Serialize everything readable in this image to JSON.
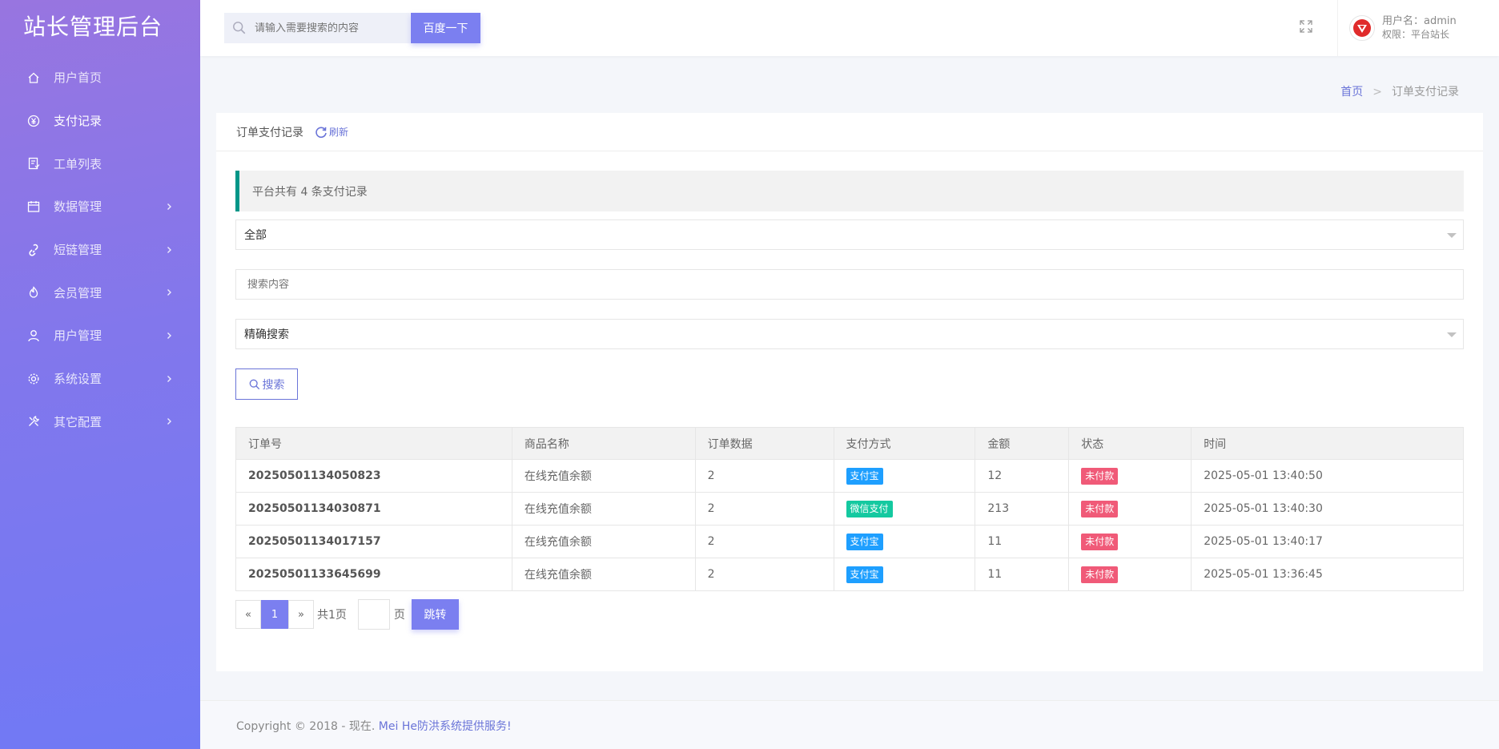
{
  "brand": "站长管理后台",
  "sidebar": {
    "items": [
      {
        "label": "用户首页",
        "icon": "home-icon",
        "has_arrow": false
      },
      {
        "label": "支付记录",
        "icon": "yen-icon",
        "has_arrow": false
      },
      {
        "label": "工单列表",
        "icon": "ticket-icon",
        "has_arrow": false
      },
      {
        "label": "数据管理",
        "icon": "calendar-icon",
        "has_arrow": true
      },
      {
        "label": "短链管理",
        "icon": "link-icon",
        "has_arrow": true
      },
      {
        "label": "会员管理",
        "icon": "fire-icon",
        "has_arrow": true
      },
      {
        "label": "用户管理",
        "icon": "user-icon",
        "has_arrow": true
      },
      {
        "label": "系统设置",
        "icon": "gear-icon",
        "has_arrow": true
      },
      {
        "label": "其它配置",
        "icon": "tools-icon",
        "has_arrow": true
      }
    ],
    "active_index": 1
  },
  "header": {
    "search_placeholder": "请输入需要搜索的内容",
    "search_button": "百度一下",
    "user_name": "用户名：admin",
    "user_role": "权限：平台站长"
  },
  "breadcrumb": {
    "home": "首页",
    "sep": ">",
    "current": "订单支付记录"
  },
  "card": {
    "title": "订单支付记录",
    "refresh_label": "刷新",
    "notice": "平台共有 4 条支付记录",
    "filter_select": "全部",
    "search_placeholder": "搜索内容",
    "mode_select": "精确搜索",
    "search_button": "搜索"
  },
  "table": {
    "headers": [
      "订单号",
      "商品名称",
      "订单数据",
      "支付方式",
      "金额",
      "状态",
      "时间"
    ],
    "rows": [
      {
        "order_no": "20250501134050823",
        "product": "在线充值余额",
        "data": "2",
        "pay": "支付宝",
        "amount": "12",
        "status": "未付款",
        "time": "2025-05-01 13:40:50"
      },
      {
        "order_no": "20250501134030871",
        "product": "在线充值余额",
        "data": "2",
        "pay": "微信支付",
        "amount": "213",
        "status": "未付款",
        "time": "2025-05-01 13:40:30"
      },
      {
        "order_no": "20250501134017157",
        "product": "在线充值余额",
        "data": "2",
        "pay": "支付宝",
        "amount": "11",
        "status": "未付款",
        "time": "2025-05-01 13:40:17"
      },
      {
        "order_no": "20250501133645699",
        "product": "在线充值余额",
        "data": "2",
        "pay": "支付宝",
        "amount": "11",
        "status": "未付款",
        "time": "2025-05-01 13:36:45"
      }
    ]
  },
  "pager": {
    "prev": "«",
    "current": "1",
    "next": "»",
    "total": "共1页",
    "unit": "页",
    "jump": "跳转"
  },
  "footer": {
    "text": "Copyright © 2018 - 现在. ",
    "link": "Mei He防洪系统提供服务!"
  },
  "colors": {
    "accent": "#7b7ff0",
    "alipay": "#1e9fff",
    "wechat": "#14c9a0",
    "unpaid": "#f05a78",
    "notice_border": "#009688"
  }
}
